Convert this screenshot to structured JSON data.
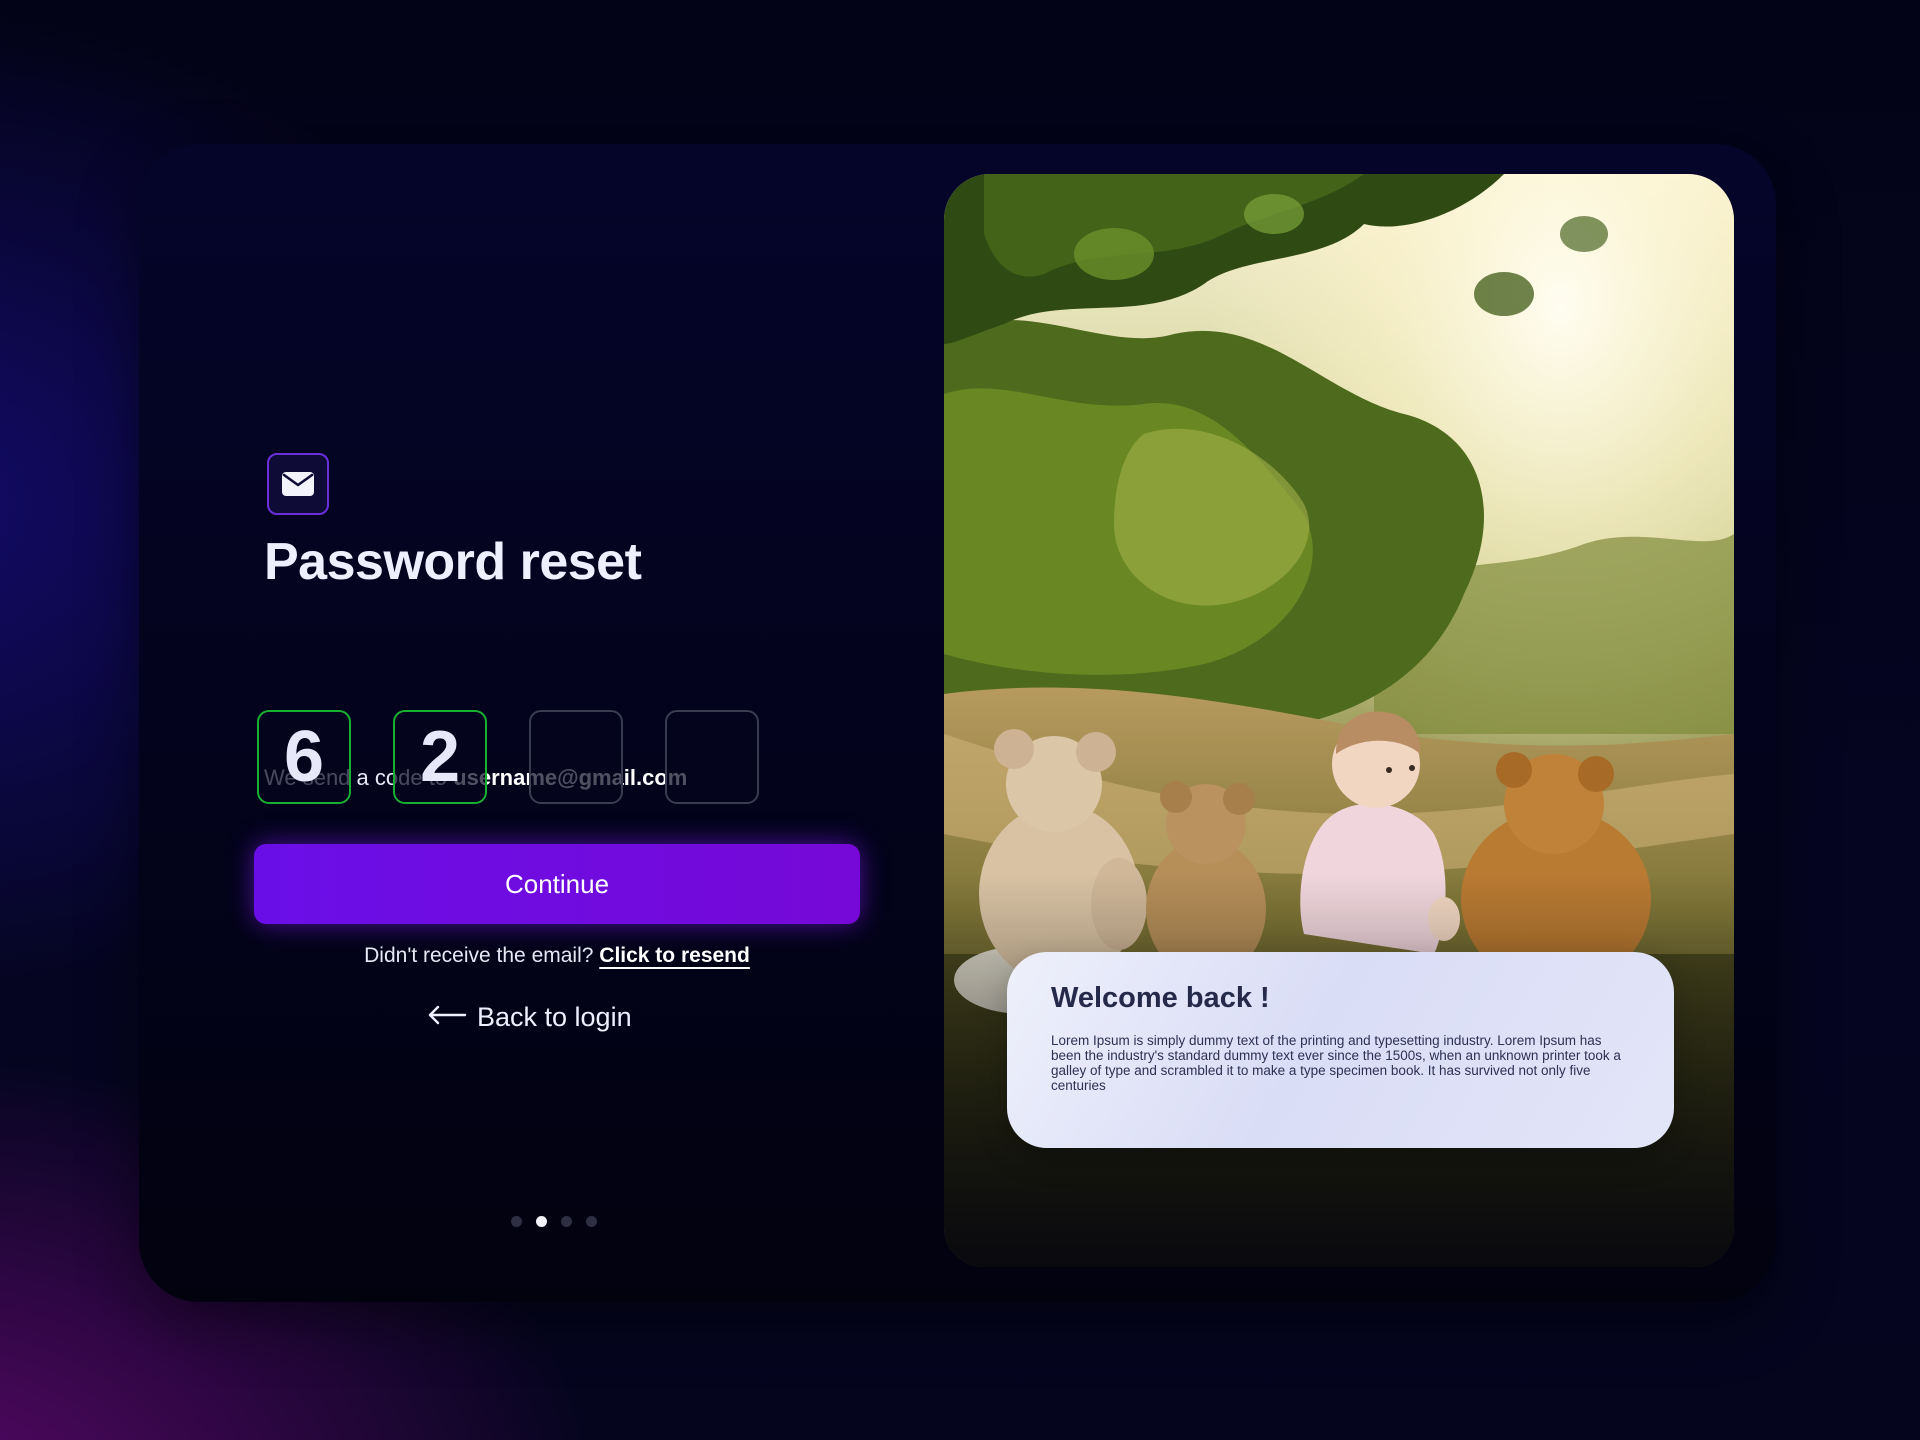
{
  "form": {
    "title": "Password reset",
    "subtitle_prefix": "We send a code to",
    "email": "username@gmail.com",
    "otp_digits": [
      "6",
      "2",
      "",
      ""
    ],
    "continue_label": "Continue",
    "resend_prefix": "Didn't receive the email?",
    "resend_link": "Click to resend",
    "back_label": "Back to login",
    "pagination": {
      "total": 4,
      "active_index": 1
    }
  },
  "welcome_card": {
    "title": "Welcome back !",
    "body": "Lorem Ipsum is simply dummy text of the printing and typesetting industry. Lorem Ipsum has been the industry's standard dummy text ever since the 1500s, when an unknown printer took a galley of type and scrambled it to make a type specimen book. It has survived not only five centuries"
  },
  "icons": {
    "header_icon": "mail-icon",
    "back_icon": "arrow-left-icon"
  },
  "colors": {
    "accent": "#7609d7",
    "otp_filled_border": "#17b130",
    "otp_empty_border": "#3a3d52",
    "card_bg": "#03031c"
  }
}
